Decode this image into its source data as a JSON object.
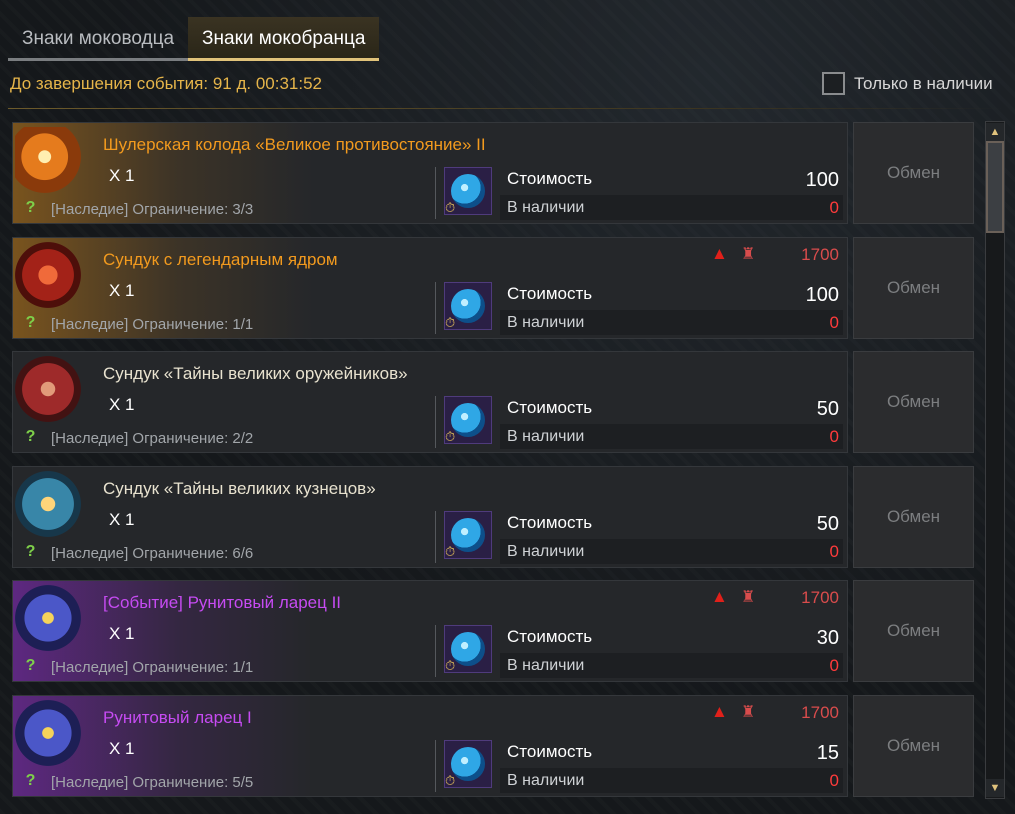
{
  "tabs": [
    {
      "label": "Знаки моководца",
      "active": false
    },
    {
      "label": "Знаки мокобранца",
      "active": true
    }
  ],
  "timer_text": "До завершения события: 91 д. 00:31:52",
  "filter": {
    "only_in_stock_label": "Только в наличии",
    "checked": false
  },
  "labels": {
    "cost": "Стоимость",
    "in_stock": "В наличии",
    "exchange": "Обмен"
  },
  "items": [
    {
      "name": "Шулерская колода «Великое противостояние» II",
      "name_color": "orange",
      "glow": "orange",
      "icon": "card-deck-icon",
      "qty": "X 1",
      "limit": "[Наследие] Ограничение: 3/3",
      "cost": "100",
      "in_stock": "0",
      "warning": false,
      "requirement": ""
    },
    {
      "name": "Сундук с легендарным ядром",
      "name_color": "orange",
      "glow": "orange",
      "icon": "legendary-chest-icon",
      "qty": "X 1",
      "limit": "[Наследие] Ограничение: 1/1",
      "cost": "100",
      "in_stock": "0",
      "warning": true,
      "requirement": "1700"
    },
    {
      "name": "Сундук «Тайны великих оружейников»",
      "name_color": "white",
      "glow": "none",
      "icon": "weaponsmith-chest-icon",
      "qty": "X 1",
      "limit": "[Наследие] Ограничение: 2/2",
      "cost": "50",
      "in_stock": "0",
      "warning": false,
      "requirement": ""
    },
    {
      "name": "Сундук «Тайны великих кузнецов»",
      "name_color": "white",
      "glow": "none",
      "icon": "blacksmith-chest-icon",
      "qty": "X 1",
      "limit": "[Наследие] Ограничение: 6/6",
      "cost": "50",
      "in_stock": "0",
      "warning": false,
      "requirement": ""
    },
    {
      "name": "[Событие] Рунитовый ларец II",
      "name_color": "purple",
      "glow": "purple",
      "icon": "runic-chest-icon",
      "qty": "X 1",
      "limit": "[Наследие] Ограничение: 1/1",
      "cost": "30",
      "in_stock": "0",
      "warning": true,
      "requirement": "1700"
    },
    {
      "name": "Рунитовый ларец I",
      "name_color": "purple",
      "glow": "purple",
      "icon": "runic-chest-icon",
      "qty": "X 1",
      "limit": "[Наследие] Ограничение: 5/5",
      "cost": "15",
      "in_stock": "0",
      "warning": true,
      "requirement": "1700"
    }
  ]
}
